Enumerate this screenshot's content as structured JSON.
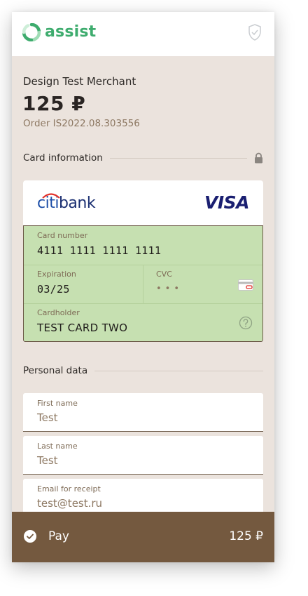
{
  "header": {
    "logo_text": "assist",
    "brand_color": "#3eac6e"
  },
  "merchant": {
    "name": "Design Test Merchant",
    "amount": "125 ₽",
    "order": "Order IS2022.08.303556"
  },
  "card_section": {
    "title": "Card information",
    "bank_name_part1": "citi",
    "bank_name_part2": "bank",
    "card_brand": "VISA",
    "card_number_label": "Card number",
    "card_number_value": "4111 1111 1111 1111",
    "expiration_label": "Expiration",
    "expiration_value": "03/25",
    "cvc_label": "CVC",
    "cvc_value": "•••",
    "cardholder_label": "Cardholder",
    "cardholder_value": "TEST CARD TWO",
    "icons": [
      "lock-icon",
      "cvc-card-icon",
      "help-icon"
    ]
  },
  "personal_section": {
    "title": "Personal data",
    "first_name_label": "First name",
    "first_name_value": "Test",
    "last_name_label": "Last name",
    "last_name_value": "Test",
    "email_label": "Email for receipt",
    "email_value": "test@test.ru"
  },
  "pay_bar": {
    "label": "Pay",
    "amount": "125 ₽",
    "color": "#74593f"
  }
}
